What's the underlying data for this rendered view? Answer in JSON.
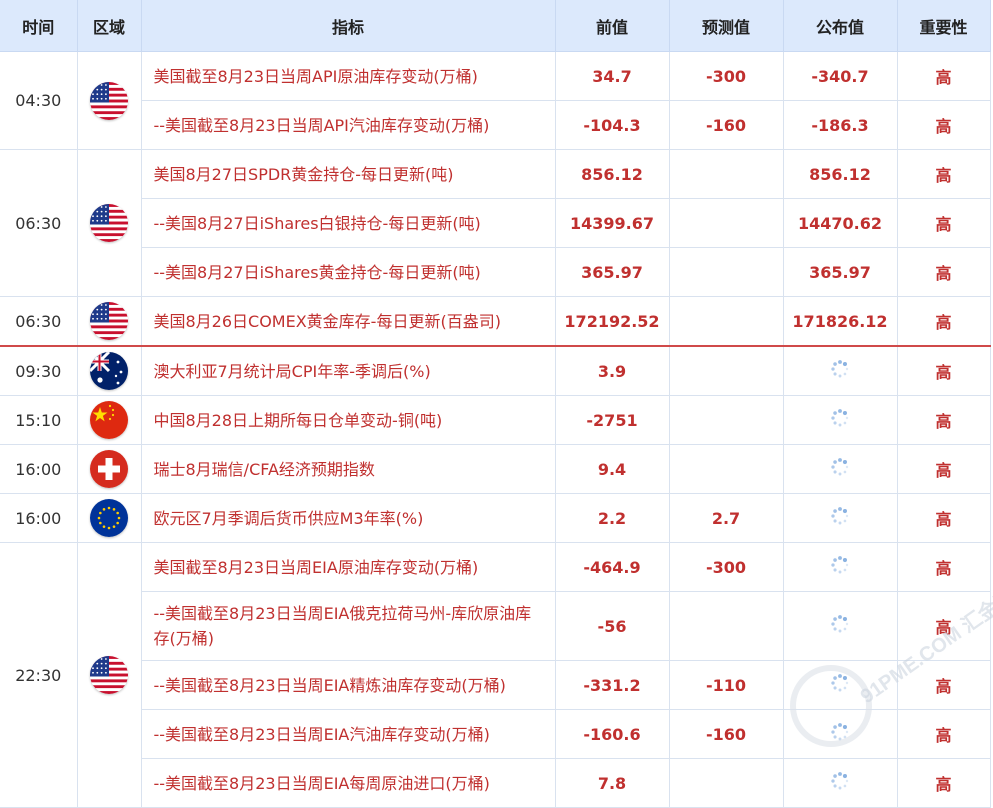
{
  "headers": [
    "时间",
    "区域",
    "指标",
    "前值",
    "预测值",
    "公布值",
    "重要性"
  ],
  "rows": [
    {
      "time": "04:30",
      "flag": "us-flag-icon",
      "name": "美国截至8月23日当周API原油库存变动(万桶)",
      "prev": "34.7",
      "forecast": "-300",
      "actual": "-340.7",
      "importance": "高"
    },
    {
      "time": "",
      "flag": "",
      "name": "--美国截至8月23日当周API汽油库存变动(万桶)",
      "prev": "-104.3",
      "forecast": "-160",
      "actual": "-186.3",
      "importance": "高"
    },
    {
      "time": "06:30",
      "flag": "us-flag-icon",
      "name": "美国8月27日SPDR黄金持仓-每日更新(吨)",
      "prev": "856.12",
      "forecast": "",
      "actual": "856.12",
      "importance": "高"
    },
    {
      "time": "",
      "flag": "",
      "name": "--美国8月27日iShares白银持仓-每日更新(吨)",
      "prev": "14399.67",
      "forecast": "",
      "actual": "14470.62",
      "importance": "高"
    },
    {
      "time": "",
      "flag": "",
      "name": "--美国8月27日iShares黄金持仓-每日更新(吨)",
      "prev": "365.97",
      "forecast": "",
      "actual": "365.97",
      "importance": "高"
    },
    {
      "time": "06:30",
      "flag": "us-flag-icon",
      "name": "美国8月26日COMEX黄金库存-每日更新(百盎司)",
      "prev": "172192.52",
      "forecast": "",
      "actual": "171826.12",
      "importance": "高"
    },
    {
      "time": "09:30",
      "flag": "au-flag-icon",
      "name": "澳大利亚7月统计局CPI年率-季调后(%)",
      "prev": "3.9",
      "forecast": "",
      "actual": "",
      "importance": "高"
    },
    {
      "time": "15:10",
      "flag": "cn-flag-icon",
      "name": "中国8月28日上期所每日仓单变动-铜(吨)",
      "prev": "-2751",
      "forecast": "",
      "actual": "",
      "importance": "高"
    },
    {
      "time": "16:00",
      "flag": "ch-flag-icon",
      "name": "瑞士8月瑞信/CFA经济预期指数",
      "prev": "9.4",
      "forecast": "",
      "actual": "",
      "importance": "高"
    },
    {
      "time": "16:00",
      "flag": "eu-flag-icon",
      "name": "欧元区7月季调后货币供应M3年率(%)",
      "prev": "2.2",
      "forecast": "2.7",
      "actual": "",
      "importance": "高"
    },
    {
      "time": "22:30",
      "flag": "us-flag-icon",
      "name": "美国截至8月23日当周EIA原油库存变动(万桶)",
      "prev": "-464.9",
      "forecast": "-300",
      "actual": "",
      "importance": "高"
    },
    {
      "time": "",
      "flag": "",
      "name": "--美国截至8月23日当周EIA俄克拉荷马州-库欣原油库存(万桶)",
      "prev": "-56",
      "forecast": "",
      "actual": "",
      "importance": "高"
    },
    {
      "time": "",
      "flag": "",
      "name": "--美国截至8月23日当周EIA精炼油库存变动(万桶)",
      "prev": "-331.2",
      "forecast": "-110",
      "actual": "",
      "importance": "高"
    },
    {
      "time": "",
      "flag": "",
      "name": "--美国截至8月23日当周EIA汽油库存变动(万桶)",
      "prev": "-160.6",
      "forecast": "-160",
      "actual": "",
      "importance": "高"
    },
    {
      "time": "",
      "flag": "",
      "name": "--美国截至8月23日当周EIA每周原油进口(万桶)",
      "prev": "7.8",
      "forecast": "",
      "actual": "",
      "importance": "高"
    }
  ],
  "watermark": "91PME.COM 汇金网"
}
